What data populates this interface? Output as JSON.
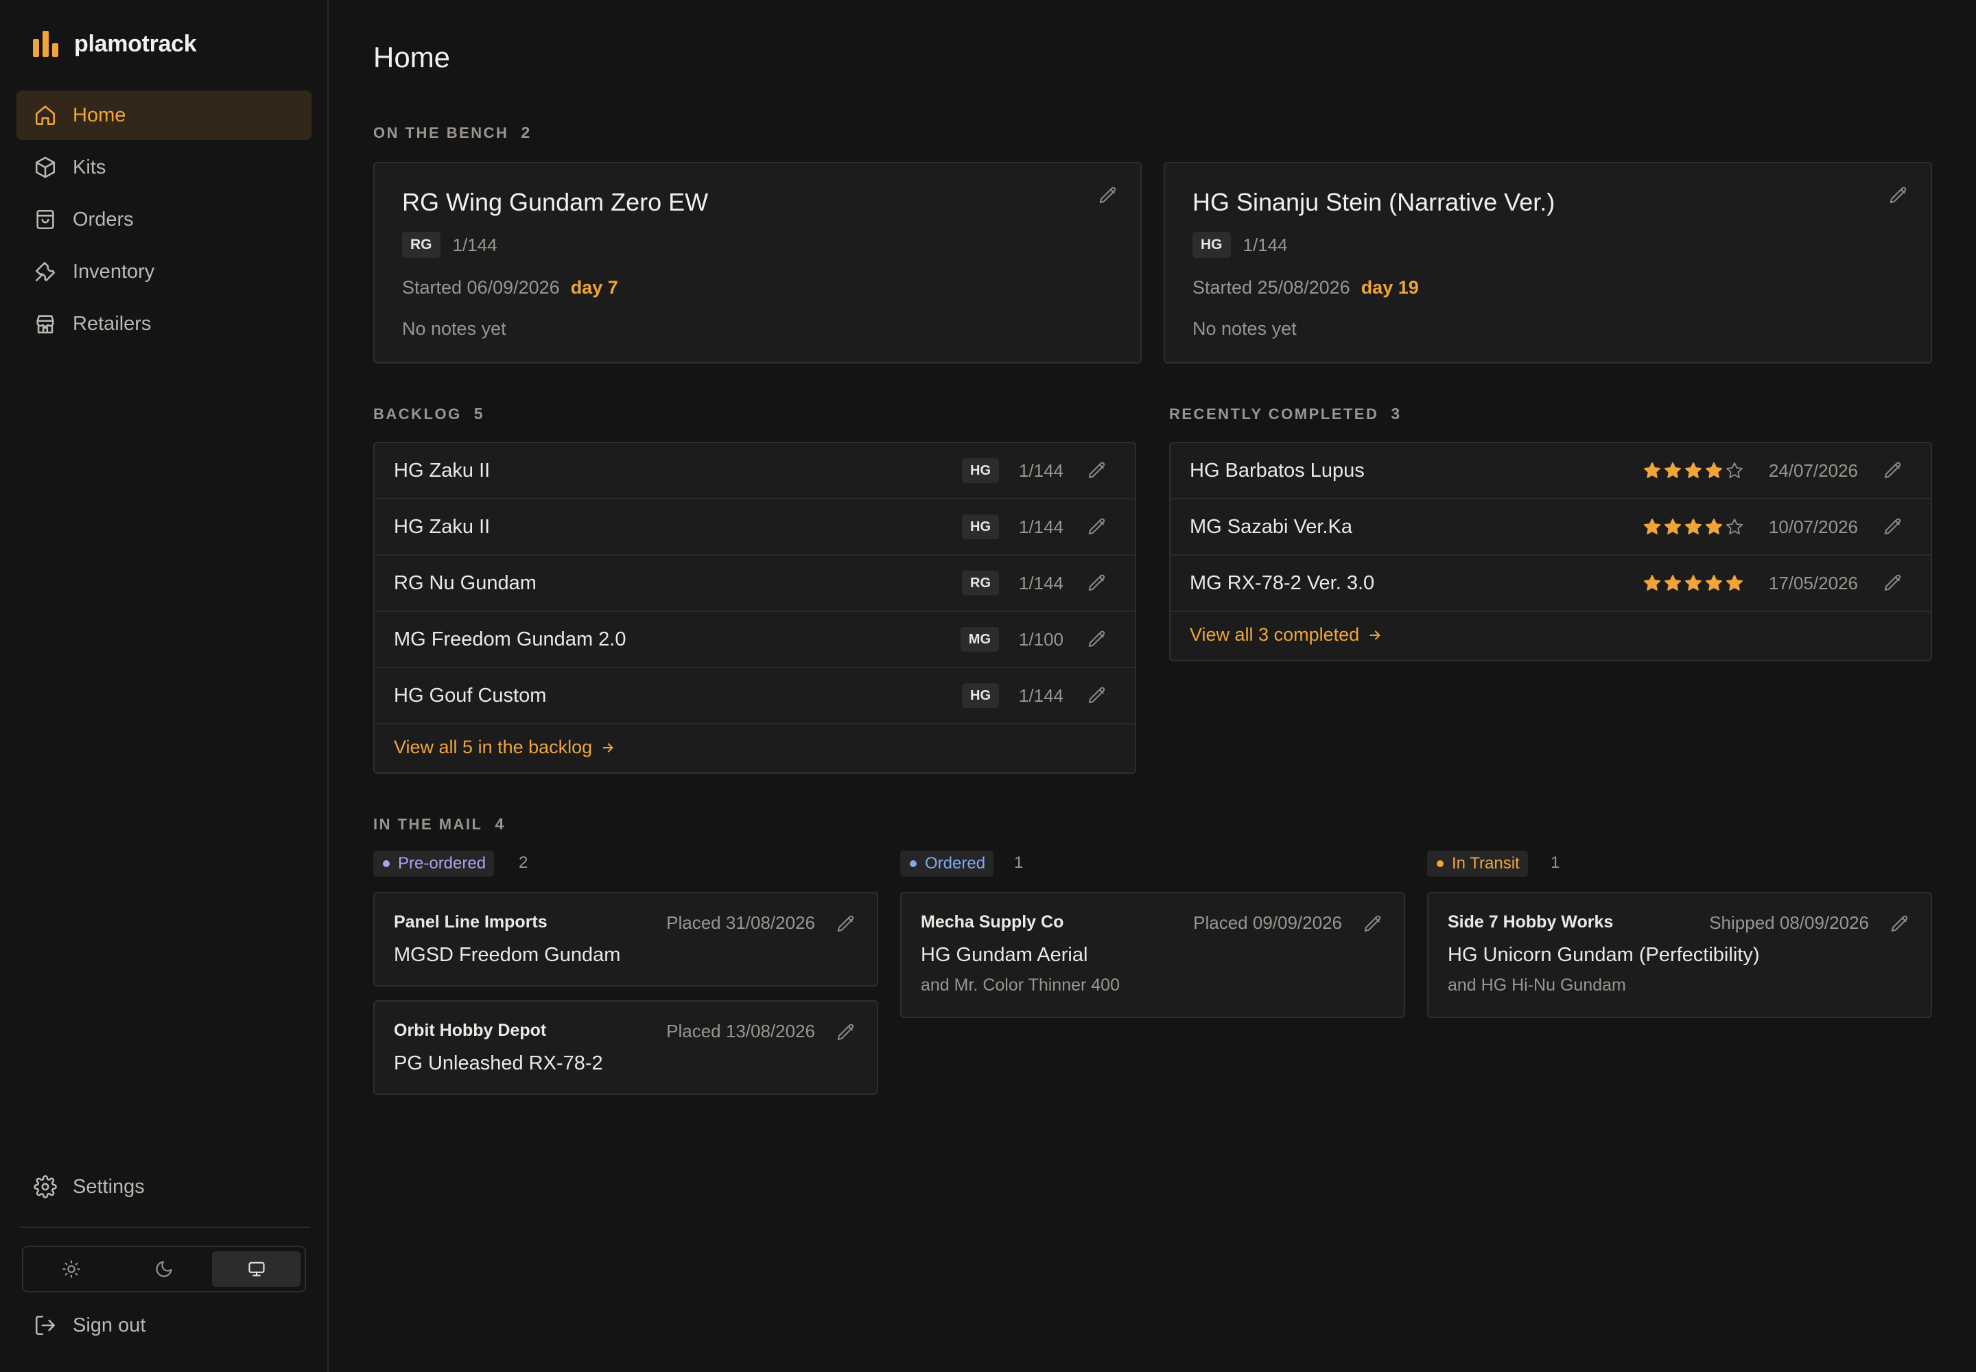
{
  "brand": {
    "name": "plamotrack",
    "accent": "#f0a53a"
  },
  "nav": {
    "items": [
      {
        "label": "Home",
        "icon": "home-icon",
        "active": true
      },
      {
        "label": "Kits",
        "icon": "box-icon"
      },
      {
        "label": "Orders",
        "icon": "bag-icon"
      },
      {
        "label": "Inventory",
        "icon": "wrench-icon"
      },
      {
        "label": "Retailers",
        "icon": "store-icon"
      }
    ],
    "settings_label": "Settings",
    "signout_label": "Sign out",
    "theme_options": [
      "light",
      "dark",
      "system"
    ],
    "theme_selected": "system"
  },
  "page": {
    "title": "Home"
  },
  "bench": {
    "label": "On the bench",
    "count": "2",
    "cards": [
      {
        "title": "RG Wing Gundam Zero EW",
        "grade": "RG",
        "scale": "1/144",
        "started": "Started 06/09/2026",
        "day": "day 7",
        "notes": "No notes yet"
      },
      {
        "title": "HG Sinanju Stein (Narrative Ver.)",
        "grade": "HG",
        "scale": "1/144",
        "started": "Started 25/08/2026",
        "day": "day 19",
        "notes": "No notes yet"
      }
    ]
  },
  "backlog": {
    "label": "Backlog",
    "count": "5",
    "rows": [
      {
        "name": "HG Zaku II",
        "grade": "HG",
        "scale": "1/144"
      },
      {
        "name": "HG Zaku II",
        "grade": "HG",
        "scale": "1/144"
      },
      {
        "name": "RG Nu Gundam",
        "grade": "RG",
        "scale": "1/144"
      },
      {
        "name": "MG Freedom Gundam 2.0",
        "grade": "MG",
        "scale": "1/100"
      },
      {
        "name": "HG Gouf Custom",
        "grade": "HG",
        "scale": "1/144"
      }
    ],
    "view_all": "View all 5 in the backlog"
  },
  "completed": {
    "label": "Recently completed",
    "count": "3",
    "rows": [
      {
        "name": "HG Barbatos Lupus",
        "rating": 4,
        "date": "24/07/2026"
      },
      {
        "name": "MG Sazabi Ver.Ka",
        "rating": 4,
        "date": "10/07/2026"
      },
      {
        "name": "MG RX-78-2 Ver. 3.0",
        "rating": 5,
        "date": "17/05/2026"
      }
    ],
    "view_all": "View all 3 completed"
  },
  "mail": {
    "label": "In the mail",
    "count": "4",
    "columns": [
      {
        "status": "Pre-ordered",
        "status_color": "#b59cf0",
        "count": "2",
        "cards": [
          {
            "retailer": "Panel Line Imports",
            "date": "Placed 31/08/2026",
            "item": "MGSD Freedom Gundam",
            "extra": ""
          },
          {
            "retailer": "Orbit Hobby Depot",
            "date": "Placed 13/08/2026",
            "item": "PG Unleashed RX-78-2",
            "extra": ""
          }
        ]
      },
      {
        "status": "Ordered",
        "status_color": "#7fa8f0",
        "count": "1",
        "cards": [
          {
            "retailer": "Mecha Supply Co",
            "date": "Placed 09/09/2026",
            "item": "HG Gundam Aerial",
            "extra": "and Mr. Color Thinner 400"
          }
        ]
      },
      {
        "status": "In Transit",
        "status_color": "#f0a53a",
        "count": "1",
        "cards": [
          {
            "retailer": "Side 7 Hobby Works",
            "date": "Shipped 08/09/2026",
            "item": "HG Unicorn Gundam (Perfectibility)",
            "extra": "and HG Hi-Nu Gundam"
          }
        ]
      }
    ]
  }
}
